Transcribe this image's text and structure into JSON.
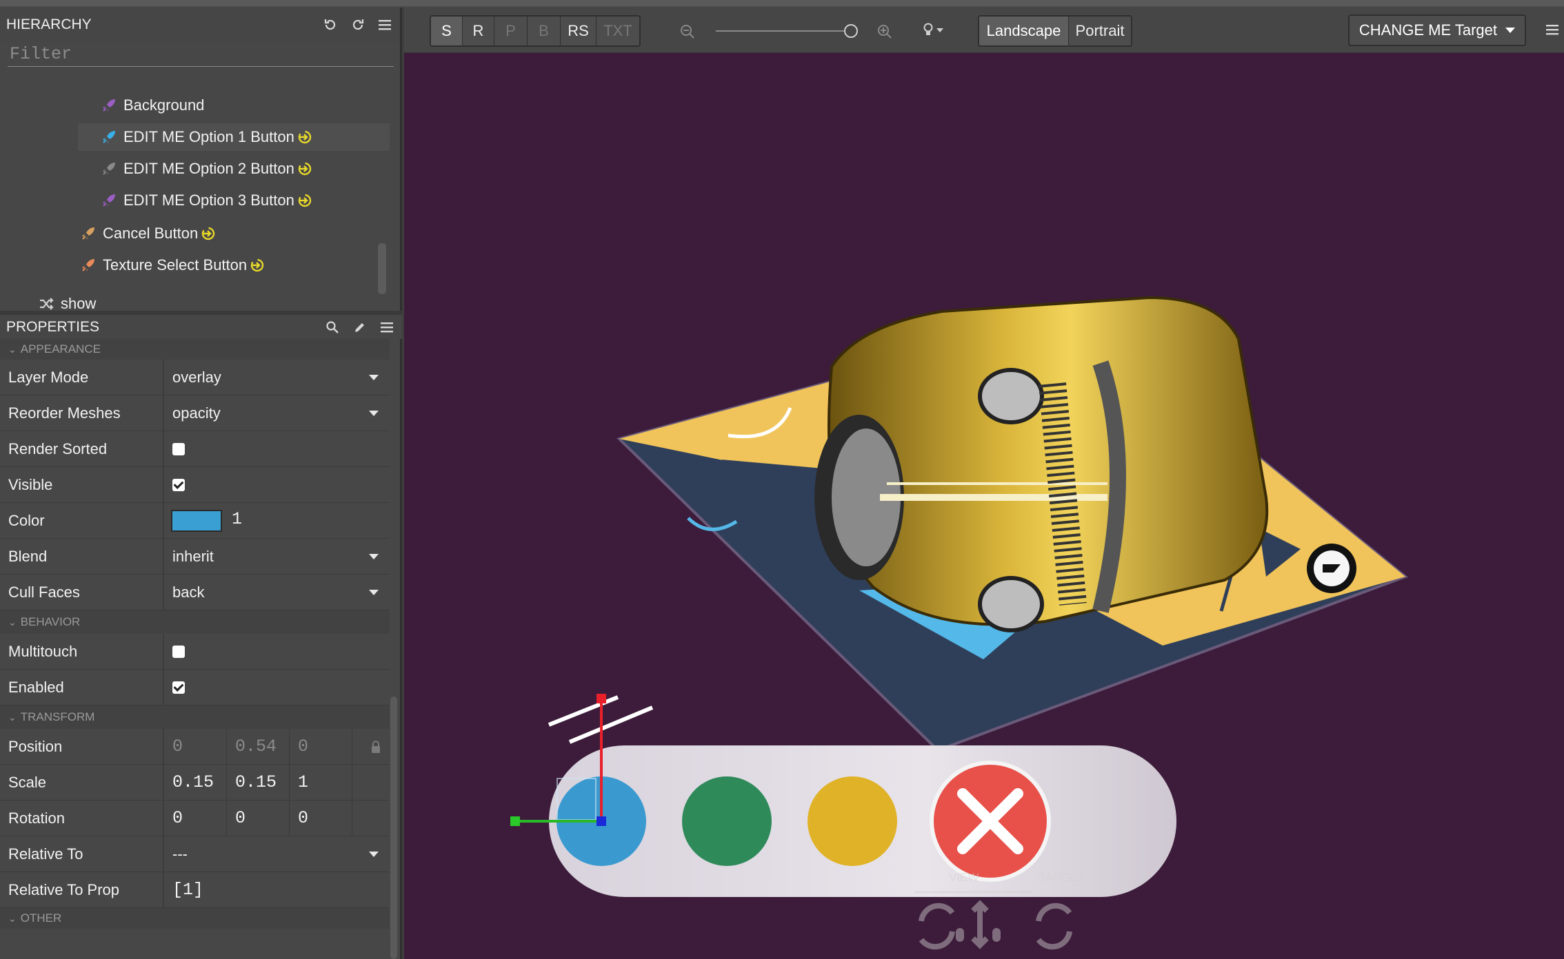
{
  "hierarchy": {
    "title": "HIERARCHY",
    "filter_placeholder": "Filter",
    "items": [
      {
        "label": "Background",
        "color": "#9a5ec4",
        "linked": false
      },
      {
        "label": "EDIT ME Option 1 Button",
        "color": "#3ab0e8",
        "linked": true
      },
      {
        "label": "EDIT ME Option 2 Button",
        "color": "#8a8a8a",
        "linked": true
      },
      {
        "label": "EDIT ME Option 3 Button",
        "color": "#9a5ec4",
        "linked": true
      },
      {
        "label": "Cancel Button",
        "color": "#d8a060",
        "linked": true
      },
      {
        "label": "Texture Select Button",
        "color": "#e88a5a",
        "linked": true
      },
      {
        "label": "show"
      }
    ]
  },
  "properties": {
    "title": "PROPERTIES",
    "sections": {
      "appearance": "APPEARANCE",
      "behavior": "BEHAVIOR",
      "transform": "TRANSFORM",
      "other": "OTHER"
    },
    "layer_mode": {
      "label": "Layer Mode",
      "value": "overlay"
    },
    "reorder_meshes": {
      "label": "Reorder Meshes",
      "value": "opacity"
    },
    "render_sorted": {
      "label": "Render Sorted",
      "checked": false
    },
    "visible": {
      "label": "Visible",
      "checked": true
    },
    "color": {
      "label": "Color",
      "swatch": "#3aa0d3",
      "alpha": "1"
    },
    "blend": {
      "label": "Blend",
      "value": "inherit"
    },
    "cull_faces": {
      "label": "Cull Faces",
      "value": "back"
    },
    "multitouch": {
      "label": "Multitouch",
      "checked": false
    },
    "enabled": {
      "label": "Enabled",
      "checked": true
    },
    "position": {
      "label": "Position",
      "x": "0",
      "y": "0.54",
      "z": "0"
    },
    "scale": {
      "label": "Scale",
      "x": "0.15",
      "y": "0.15",
      "z": "1"
    },
    "rotation": {
      "label": "Rotation",
      "x": "0",
      "y": "0",
      "z": "0"
    },
    "relative_to": {
      "label": "Relative To",
      "value": "---"
    },
    "relative_to_prop": {
      "label": "Relative To Prop",
      "value": "[1]"
    }
  },
  "toolbar": {
    "modes": [
      "S",
      "R",
      "P",
      "B",
      "RS",
      "TXT"
    ],
    "orientation": [
      "Landscape",
      "Portrait"
    ],
    "target_label": "CHANGE ME Target",
    "zoom_level": 0.98
  },
  "viewport": {
    "bg": "#3c1c3a",
    "buttons": [
      {
        "color": "#3a9ad0"
      },
      {
        "color": "#2f8a5a"
      },
      {
        "color": "#e0b227"
      },
      {
        "color": "#e8504a"
      }
    ],
    "overlay_view": "VIEW",
    "overlay_target": "TARGET"
  }
}
